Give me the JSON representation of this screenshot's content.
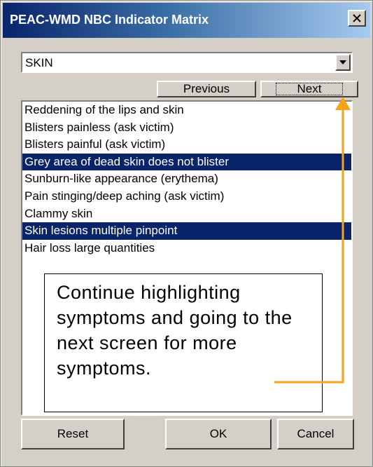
{
  "window": {
    "title": "PEAC-WMD NBC Indicator Matrix"
  },
  "combo": {
    "value": "SKIN",
    "icon": "chevron-down-icon"
  },
  "nav": {
    "previous_label": "Previous",
    "next_label": "Next"
  },
  "symptoms": [
    {
      "label": "Reddening of the lips and skin",
      "selected": false
    },
    {
      "label": "Blisters painless (ask victim)",
      "selected": false
    },
    {
      "label": "Blisters painful (ask victim)",
      "selected": false
    },
    {
      "label": "Grey area of dead skin does not blister",
      "selected": true
    },
    {
      "label": "Sunburn-like appearance (erythema)",
      "selected": false
    },
    {
      "label": "Pain stinging/deep aching (ask victim)",
      "selected": false
    },
    {
      "label": "Clammy skin",
      "selected": false
    },
    {
      "label": "Skin lesions multiple pinpoint",
      "selected": true
    },
    {
      "label": "Hair loss large quantities",
      "selected": false
    }
  ],
  "callout": {
    "text": "Continue highlighting symptoms and going to the next screen for more symptoms."
  },
  "footer": {
    "reset_label": "Reset",
    "ok_label": "OK",
    "cancel_label": "Cancel"
  },
  "colors": {
    "selection": "#0a246a",
    "callout_arrow": "#f7a21b",
    "title_bar": "#0a246a"
  }
}
